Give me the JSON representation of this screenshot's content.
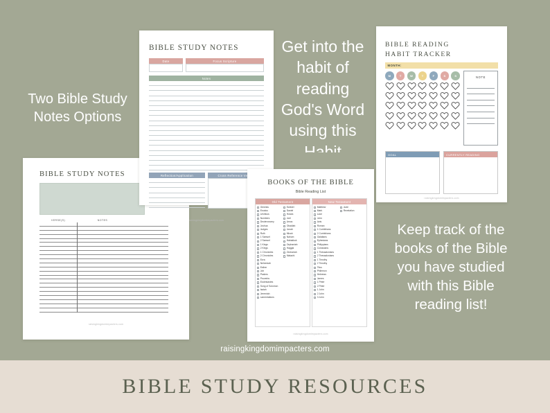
{
  "banner": {
    "title": "BIBLE STUDY RESOURCES",
    "bg_color": "#e6ddd3",
    "text_color": "#5b6150"
  },
  "background": {
    "color": "#a3a894"
  },
  "site_url": "raisingkingdomimpacters.com",
  "promos": {
    "left": "Two Bible Study Notes Options",
    "middle": "Get into the habit of reading God's Word using this Habit",
    "right": "Keep track of the books of the Bible you have studied with this Bible reading list!"
  },
  "sheet_notes_1": {
    "title": "BIBLE STUDY NOTES",
    "date_label": "Date",
    "scripture_label": "Focus Scripture",
    "notes_label": "Notes",
    "reflection_label": "Reflection/Application",
    "cross_reference_label": "Cross Reference Verses",
    "footer": "raisingkingdomimpacters.com",
    "colors": {
      "pink": "#d9a6a0",
      "green": "#9fb3a1",
      "blue": "#92a4b8"
    }
  },
  "sheet_notes_2": {
    "title": "BIBLE STUDY NOTES",
    "verses_header": "VERSE(S)",
    "notes_header": "NOTES",
    "footer": "raisingkingdomimpacters.com",
    "box_color": "#cfd9d1"
  },
  "sheet_books": {
    "title": "BOOKS OF THE BIBLE",
    "subtitle": "Bible Reading List",
    "footer": "raisingkingdomimpacters.com",
    "old_testament": {
      "header": "Old Testament",
      "header_color": "#d9a6a0",
      "column_1": [
        "Genesis",
        "Exodus",
        "Leviticus",
        "Numbers",
        "Deuteronomy",
        "Joshua",
        "Judges",
        "Ruth",
        "1 Samuel",
        "2 Samuel",
        "1 Kings",
        "2 Kings",
        "1 Chronicles",
        "2 Chronicles",
        "Ezra",
        "Nehemiah",
        "Esther",
        "Job",
        "Psalms",
        "Proverbs",
        "Ecclesiastes",
        "Song of Solomon",
        "Isaiah",
        "Jeremiah",
        "Lamentations"
      ],
      "column_2": [
        "Ezekiel",
        "Daniel",
        "Hosea",
        "Joel",
        "Amos",
        "Obadiah",
        "Jonah",
        "Micah",
        "Nahum",
        "Habakkuk",
        "Zephaniah",
        "Haggai",
        "Zechariah",
        "Malachi"
      ]
    },
    "new_testament": {
      "header": "New Testament",
      "header_color": "#e3b4b0",
      "column_1": [
        "Matthew",
        "Mark",
        "Luke",
        "John",
        "Acts",
        "Roman",
        "1 Corinthians",
        "2 Corinthians",
        "Galatians",
        "Ephesians",
        "Philippians",
        "Colossians",
        "1 Thessalonians",
        "2 Thessalonians",
        "1 Timothy",
        "2 Timothy",
        "Titus",
        "Philemon",
        "Hebrews",
        "James",
        "1 Peter",
        "2 Peter",
        "1 John",
        "2 John",
        "3 John"
      ],
      "column_2": [
        "Jude",
        "Revelation"
      ]
    }
  },
  "sheet_habit": {
    "title_line_1": "BIBLE READING",
    "title_line_2": "HABIT TRACKER",
    "month_label": "MONTH:",
    "month_color": "#f2dfa8",
    "note_label": "NOTE",
    "goal_label": "GOAL",
    "goal_color": "#7f9cb5",
    "currently_reading_label": "CURRENTLY READING",
    "currently_reading_color": "#dba39d",
    "footer": "raisingkingdomimpacters.com",
    "days": [
      {
        "letter": "M",
        "color": "#8fa9bd"
      },
      {
        "letter": "T",
        "color": "#e0aaa4"
      },
      {
        "letter": "W",
        "color": "#a7bda8"
      },
      {
        "letter": "T",
        "color": "#ecd38c"
      },
      {
        "letter": "F",
        "color": "#8fa9bd"
      },
      {
        "letter": "S",
        "color": "#e0aaa4"
      },
      {
        "letter": "S",
        "color": "#a7bda8"
      }
    ],
    "heart_rows": 5,
    "heart_cols": 7,
    "note_lines": 7
  }
}
